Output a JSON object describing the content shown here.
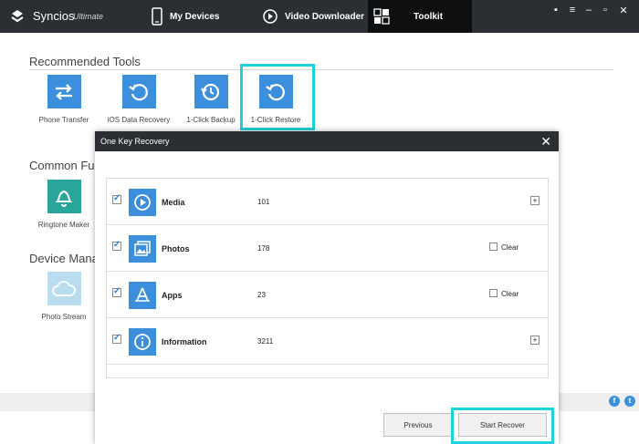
{
  "app": {
    "name": "Syncios",
    "edition": "Ultimate"
  },
  "nav": {
    "my_devices": "My Devices",
    "video_downloader": "Video Downloader",
    "toolkit": "Toolkit"
  },
  "sections": {
    "recommended": "Recommended Tools",
    "common": "Common Fu",
    "device": "Device Mana"
  },
  "tools": {
    "recommended": [
      {
        "label": "Phone Transfer",
        "icon": "transfer-arrows-icon"
      },
      {
        "label": "iOS Data Recovery",
        "icon": "recovery-icon"
      },
      {
        "label": "1-Click Backup",
        "icon": "backup-clock-icon"
      },
      {
        "label": "1-Click Restore",
        "icon": "restore-icon"
      }
    ],
    "common": [
      {
        "label": "Ringtone Maker",
        "icon": "bell-icon"
      }
    ],
    "device": [
      {
        "label": "Photo Stream",
        "icon": "cloud-icon"
      }
    ]
  },
  "dialog": {
    "title": "One Key Recovery",
    "rows": [
      {
        "name": "Media",
        "count": "101",
        "checked": true,
        "icon": "play-icon",
        "action": "expand"
      },
      {
        "name": "Photos",
        "count": "178",
        "checked": true,
        "icon": "photos-icon",
        "action": "clear",
        "clear_label": "Clear"
      },
      {
        "name": "Apps",
        "count": "23",
        "checked": true,
        "icon": "apps-icon",
        "action": "clear",
        "clear_label": "Clear"
      },
      {
        "name": "Information",
        "count": "3211",
        "checked": true,
        "icon": "info-icon",
        "action": "expand"
      }
    ],
    "previous_label": "Previous",
    "start_label": "Start Recover"
  },
  "colors": {
    "titlebar": "#2b2f33",
    "accent": "#3b8fdc",
    "highlight": "#1fd1d8"
  }
}
